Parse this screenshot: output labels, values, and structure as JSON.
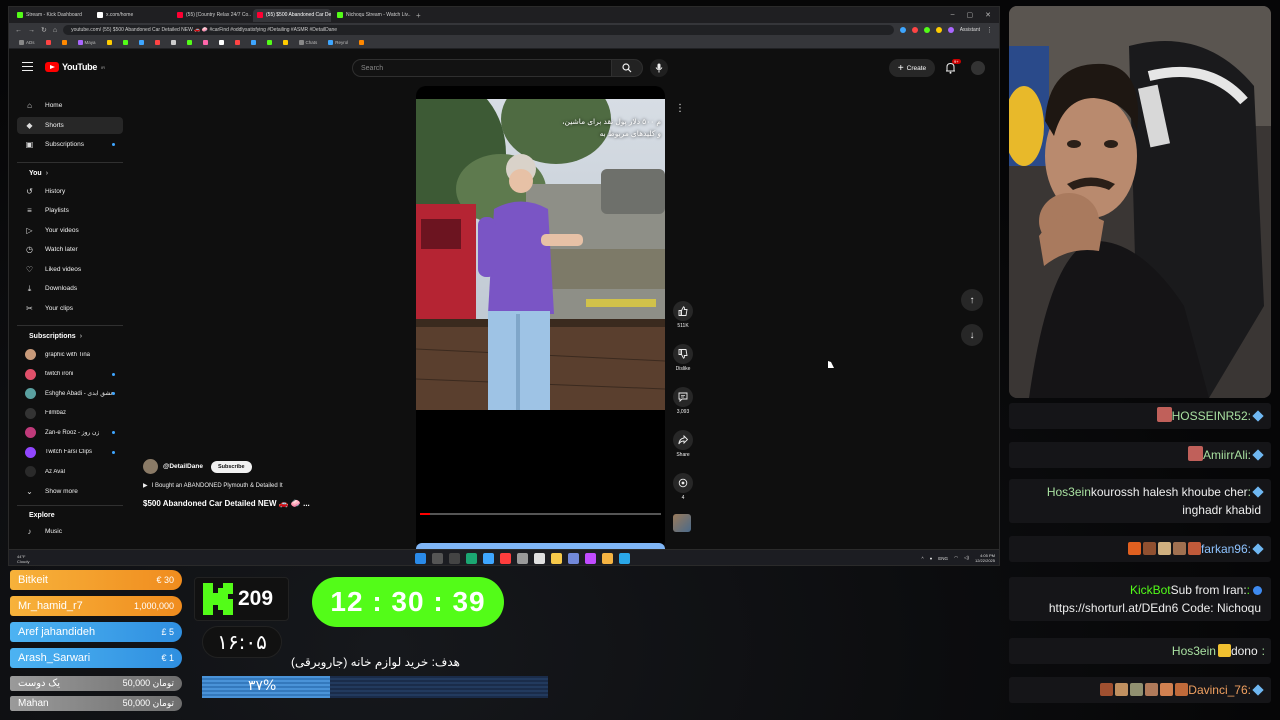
{
  "browser": {
    "tabs": [
      {
        "title": "Stream - Kick Dashboard",
        "color": "#53fc18",
        "active": false
      },
      {
        "title": "x.com/home",
        "color": "#ffffff",
        "active": false
      },
      {
        "title": "(55) [Country Relax 24/7 Co...",
        "color": "#ff0033",
        "active": false
      },
      {
        "title": "(55) $500 Abandoned Car De...",
        "color": "#ff0033",
        "active": true
      },
      {
        "title": "Nichoqu Stream - Watch Liv...",
        "color": "#53fc18",
        "active": false
      }
    ],
    "url": "youtube.com/ (55) $500 Abandoned Car Detailed NEW 🚗 🧼 #carFind #oddlysatisfying #Detailing #ASMR #DetailDane",
    "assistant_label": "Assistant",
    "bookmarks": [
      {
        "label": "ADs",
        "color": "#888"
      },
      {
        "label": "",
        "color": "#ff4444"
      },
      {
        "label": "",
        "color": "#ff8800"
      },
      {
        "label": "Maya",
        "color": "#aa66ff"
      },
      {
        "label": "",
        "color": "#ffcc00"
      },
      {
        "label": "",
        "color": "#53fc18"
      },
      {
        "label": "",
        "color": "#3ea6ff"
      },
      {
        "label": "",
        "color": "#ff4444"
      },
      {
        "label": "",
        "color": "#cccccc"
      },
      {
        "label": "",
        "color": "#53fc18"
      },
      {
        "label": "",
        "color": "#ff66aa"
      },
      {
        "label": "",
        "color": "#ffffff"
      },
      {
        "label": "",
        "color": "#ff4444"
      },
      {
        "label": "",
        "color": "#3ea6ff"
      },
      {
        "label": "",
        "color": "#53fc18"
      },
      {
        "label": "",
        "color": "#ffcc00"
      },
      {
        "label": "Chats",
        "color": "#888"
      },
      {
        "label": "Reyrol",
        "color": "#3ea6ff"
      },
      {
        "label": "",
        "color": "#ff8800"
      }
    ]
  },
  "youtube": {
    "logo_text": "YouTube",
    "logo_region": "IR",
    "search_placeholder": "Search",
    "create_label": "Create",
    "notif_count": "9+",
    "sidebar": {
      "main": [
        {
          "label": "Home",
          "icon": "home-icon",
          "glyph": "⌂"
        },
        {
          "label": "Shorts",
          "icon": "shorts-icon",
          "glyph": "◆"
        },
        {
          "label": "Subscriptions",
          "icon": "subscriptions-icon",
          "glyph": "▣"
        }
      ],
      "you_heading": "You",
      "you": [
        {
          "label": "History",
          "icon": "history-icon",
          "glyph": "↺"
        },
        {
          "label": "Playlists",
          "icon": "playlists-icon",
          "glyph": "≡"
        },
        {
          "label": "Your videos",
          "icon": "your-videos-icon",
          "glyph": "▷"
        },
        {
          "label": "Watch later",
          "icon": "watch-later-icon",
          "glyph": "◷"
        },
        {
          "label": "Liked videos",
          "icon": "liked-videos-icon",
          "glyph": "♡"
        },
        {
          "label": "Downloads",
          "icon": "downloads-icon",
          "glyph": "⤓"
        },
        {
          "label": "Your clips",
          "icon": "clips-icon",
          "glyph": "✂"
        }
      ],
      "subs_heading": "Subscriptions",
      "subscriptions": [
        {
          "label": "graphic with Tina",
          "color": "#c89a7a",
          "live": false
        },
        {
          "label": "twitch ironi",
          "color": "#e0506a",
          "live": true
        },
        {
          "label": "Eshghe Abadi - عشق ابدی",
          "color": "#5aa0a0",
          "live": true
        },
        {
          "label": "Filmbaz",
          "color": "#333333",
          "live": false
        },
        {
          "label": "Zan-e Rooz - زن روز",
          "color": "#c03a7a",
          "live": true
        },
        {
          "label": "Twitch Farsi Clips",
          "color": "#9146ff",
          "live": true
        },
        {
          "label": "Az Aval",
          "color": "#2a2a2a",
          "live": false
        }
      ],
      "show_more": "Show more",
      "explore_heading": "Explore",
      "explore": [
        {
          "label": "Music",
          "icon": "music-icon",
          "glyph": "♪"
        }
      ]
    },
    "short": {
      "overlay_line1": "م ۵۰۰ دلار پول نقد برای ماشین،",
      "overlay_line2": "و کلیدهای مربوط به",
      "channel_handle": "@DetailDane",
      "subscribe_label": "Subscribe",
      "related_title": "I Bought an ABANDONED Plymouth & Detailed It",
      "title": "$500 Abandoned Car Detailed NEW 🚗 🧼 ...",
      "likes": "511K",
      "dislike_label": "Dislike",
      "comments": "3,093",
      "share_label": "Share",
      "remix_count": "4",
      "progress": 0.04
    },
    "taskbar": {
      "weather_temp": "44°F",
      "weather_text": "Cloudy",
      "lang": "ENG",
      "time": "4:05 PM",
      "date": "12/22/2025"
    }
  },
  "chat": [
    {
      "user": ":HOSSEINR52",
      "user_color": "#a8e0a0",
      "text": "",
      "badge": "gem",
      "emotes": [],
      "avatar_color": "#c0605a"
    },
    {
      "user": ":AmiirrAli",
      "user_color": "#a8e0a0",
      "text": "",
      "badge": "gem",
      "emotes": [],
      "avatar_color": "#c0605a"
    },
    {
      "user": ":Hos3ein",
      "user_color": "#a8e0a0",
      "text": "kourossh halesh khoube cher inghadr khabid",
      "badge": "gem",
      "emotes": [],
      "avatar_color": ""
    },
    {
      "user": ":farkan96",
      "user_color": "#8ec3ff",
      "text": "",
      "badge": "gem",
      "emotes": [
        "#c05a3a",
        "#a07050",
        "#d0b080",
        "#905030",
        "#e06020"
      ],
      "avatar_color": ""
    },
    {
      "user": ":KickBot",
      "user_color": "#53fc18",
      "text": "Sub from Iran: https://shorturl.at/DEdn6 Code: Nichoqu",
      "badge": "verified",
      "emotes": [],
      "avatar_color": ""
    },
    {
      "user": ":Hos3ein",
      "user_color": "#a8e0a0",
      "text": "dono",
      "badge": "",
      "emotes": [
        "#f0c030"
      ],
      "avatar_color": ""
    },
    {
      "user": ":Davinci_76",
      "user_color": "#f0a060",
      "text": "",
      "badge": "gem",
      "emotes": [
        "#c06a3a",
        "#d08050",
        "#b07a5a",
        "#909070",
        "#c09060",
        "#a05030"
      ],
      "avatar_color": ""
    }
  ],
  "donations": [
    {
      "name": "Bitkeit",
      "amount": "€ 30",
      "bg": "linear-gradient(90deg,#f7b23b,#f08c1e)"
    },
    {
      "name": "Mr_hamid_r7",
      "amount": "1,000,000",
      "bg": "linear-gradient(90deg,#f7b23b,#f08c1e)"
    },
    {
      "name": "Aref jahandideh",
      "amount": "£ 5",
      "bg": "linear-gradient(90deg,#4db3f2,#2f8fe0)"
    },
    {
      "name": "Arash_Sarwari",
      "amount": "€ 1",
      "bg": "linear-gradient(90deg,#4db3f2,#2f8fe0)"
    },
    {
      "name": "یک دوست",
      "amount": "50,000 تومان",
      "bg": ""
    },
    {
      "name": "Mahan",
      "amount": "50,000 تومان",
      "bg": ""
    }
  ],
  "overlay": {
    "kick_followers": "209",
    "timer": "12 : 30 : 39",
    "clock": "۱۶:۰۵",
    "goal_label": "هدف: خرید لوازم خانه (جاروبرقی)",
    "goal_percent_text": "۳۷%",
    "goal_fraction": 0.37
  }
}
